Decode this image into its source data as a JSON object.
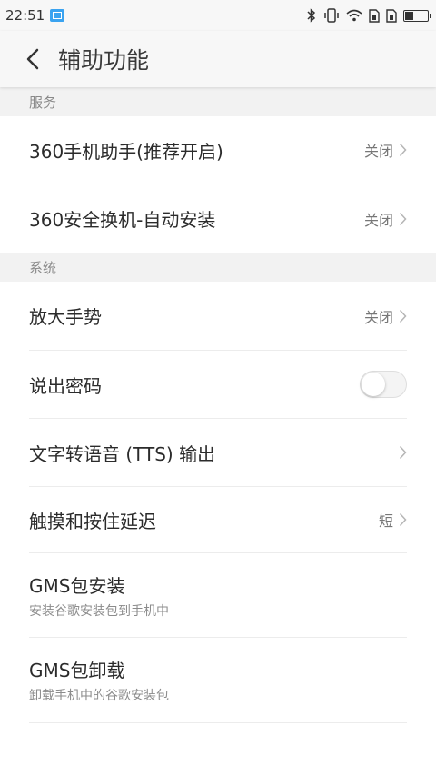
{
  "status_bar": {
    "time": "22:51"
  },
  "header": {
    "title": "辅助功能"
  },
  "sections": [
    {
      "header": "服务",
      "items": [
        {
          "title": "360手机助手(推荐开启)",
          "value": "关闭"
        },
        {
          "title": "360安全换机-自动安装",
          "value": "关闭"
        }
      ]
    },
    {
      "header": "系统",
      "items": [
        {
          "title": "放大手势",
          "value": "关闭"
        },
        {
          "title": "说出密码",
          "toggle": false
        },
        {
          "title": "文字转语音 (TTS) 输出"
        },
        {
          "title": "触摸和按住延迟",
          "value": "短"
        },
        {
          "title": "GMS包安装",
          "subtitle": "安装谷歌安装包到手机中"
        },
        {
          "title": "GMS包卸载",
          "subtitle": "卸载手机中的谷歌安装包"
        }
      ]
    }
  ],
  "colors": {
    "status_icon_accent": "#3aa3f0",
    "section_bg": "#f2f2f2",
    "divider": "#ececec"
  }
}
